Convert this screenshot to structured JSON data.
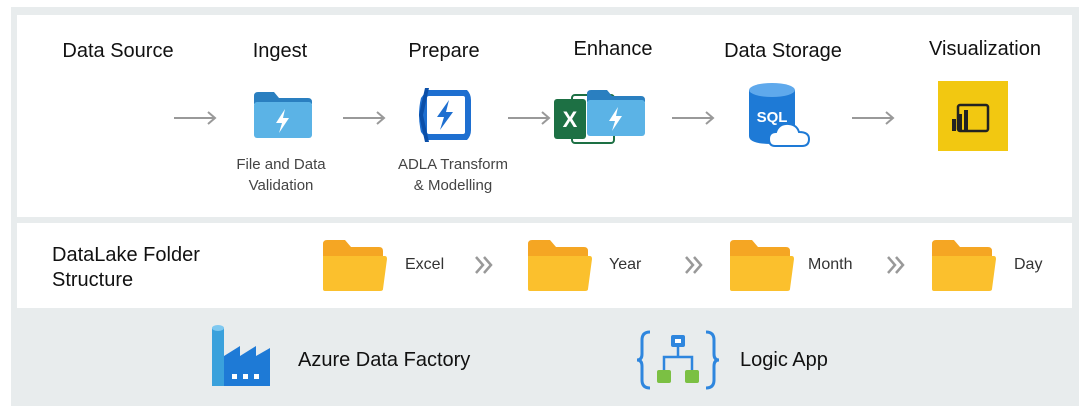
{
  "pipeline": {
    "stages": [
      {
        "title": "Data Source",
        "icon": "excel-icon",
        "caption": []
      },
      {
        "title": "Ingest",
        "icon": "data-lake-folder-icon",
        "caption": [
          "File and Data",
          "Validation"
        ]
      },
      {
        "title": "Prepare",
        "icon": "data-lake-analytics-icon",
        "caption": [
          "ADLA Transform",
          "& Modelling"
        ]
      },
      {
        "title": "Enhance",
        "icon": "data-lake-folder-icon",
        "caption": []
      },
      {
        "title": "Data Storage",
        "icon": "sql-database-icon",
        "caption": []
      },
      {
        "title": "Visualization",
        "icon": "power-bi-icon",
        "caption": []
      }
    ],
    "arrow_icon": "right-arrow-icon"
  },
  "datalake": {
    "title_lines": [
      "DataLake Folder",
      "Structure"
    ],
    "folders": [
      "Excel",
      "Year",
      "Month",
      "Day"
    ],
    "separator_icon": "double-chevron-icon"
  },
  "services": [
    {
      "label": "Azure Data Factory",
      "icon": "azure-data-factory-icon"
    },
    {
      "label": "Logic App",
      "icon": "logic-app-icon"
    }
  ],
  "colors": {
    "background": "#e8eced",
    "panel": "#ffffff",
    "excel_green": "#1d7044",
    "lake_blue": "#3aa1dc",
    "sql_blue": "#1e7ad6",
    "powerbi_yellow": "#f2c811",
    "folder_orange": "#f5a623",
    "folder_yellow": "#fbc02d",
    "logic_green": "#7bc043",
    "logic_blue": "#2e86de"
  }
}
